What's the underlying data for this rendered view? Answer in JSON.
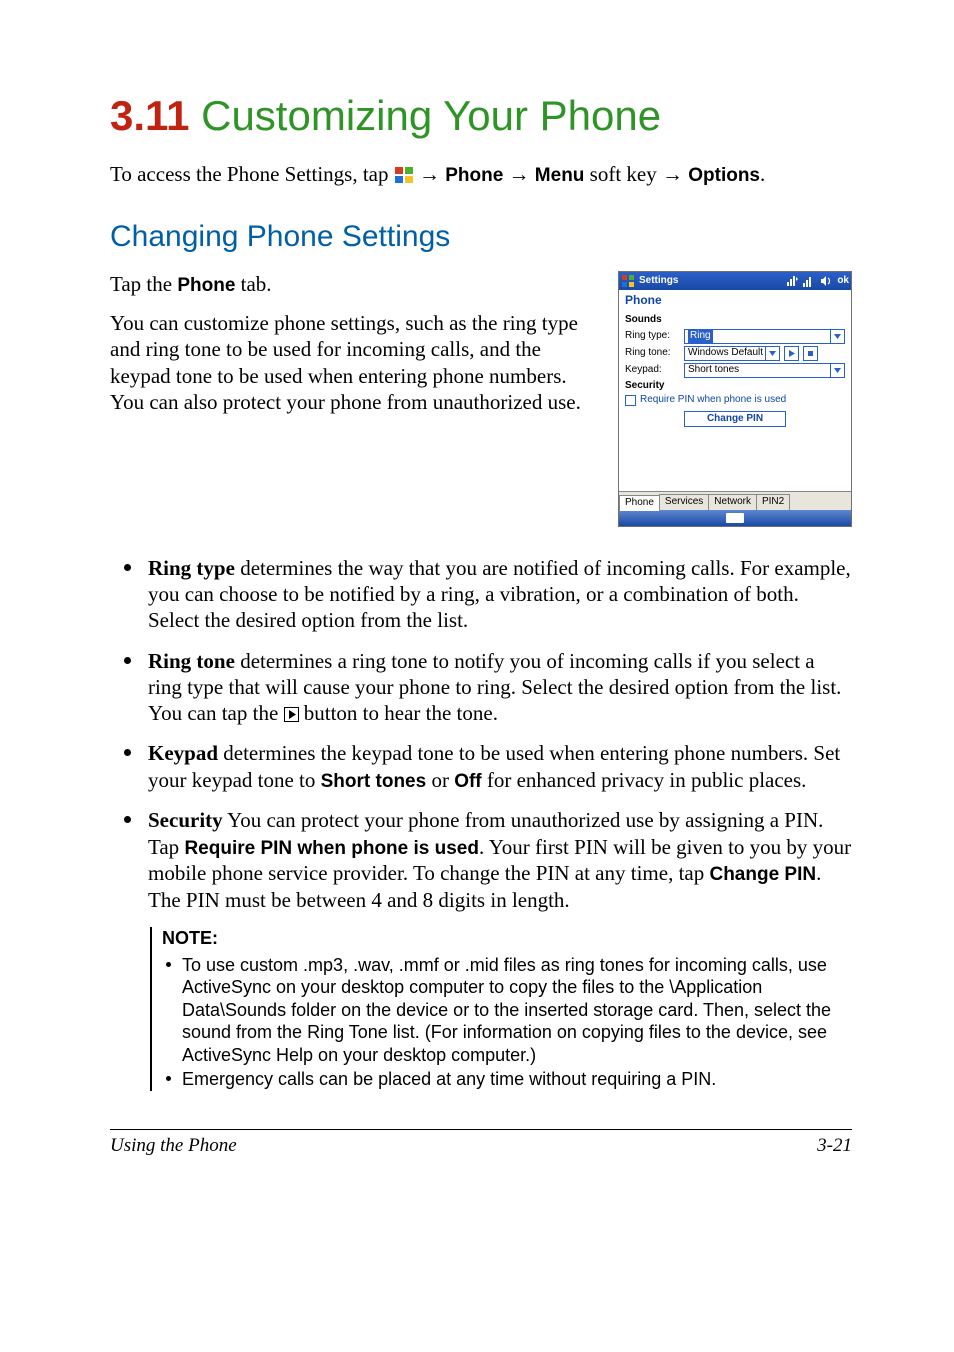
{
  "heading": {
    "number": "3.11",
    "title": "Customizing Your Phone"
  },
  "access_line": {
    "prefix": "To access the Phone Settings, tap ",
    "step1": "Phone",
    "step2": "Menu",
    "mid2": " soft key ",
    "step3": "Options",
    "arrow": "→",
    "period": "."
  },
  "subsection_title": "Changing Phone Settings",
  "intro1_prefix": "Tap the ",
  "intro1_bold": "Phone",
  "intro1_suffix": " tab.",
  "intro2": "You can customize phone settings, such as the ring type and ring tone to be used for incoming calls, and the keypad tone to be used when entering phone numbers. You can also protect your phone from unauthorized use.",
  "screenshot": {
    "title": "Settings",
    "ok": "ok",
    "heading": "Phone",
    "sections": {
      "sounds": "Sounds",
      "ring_type_label": "Ring type:",
      "ring_type_value": "Ring",
      "ring_tone_label": "Ring tone:",
      "ring_tone_value": "Windows Default",
      "keypad_label": "Keypad:",
      "keypad_value": "Short tones",
      "security": "Security",
      "pin_require": "Require PIN when phone is used",
      "change_pin_btn": "Change PIN"
    },
    "tabs": [
      "Phone",
      "Services",
      "Network",
      "PIN2"
    ]
  },
  "bullets": {
    "ring_type": {
      "label": "Ring type",
      "text": "  determines the way that you are notified of incoming calls. For example, you can choose to be notified by a ring, a vibration, or a combination of both. Select the desired option from the list."
    },
    "ring_tone": {
      "label": "Ring tone",
      "pre": "  determines a ring tone to notify you of incoming calls if you select a ring type that will cause your phone to ring. Select the desired option from the list. You can tap the ",
      "post": " button to hear the tone."
    },
    "keypad": {
      "label": "Keypad",
      "pre": "  determines the keypad tone to be used when entering phone numbers. Set your keypad tone to ",
      "opt1": "Short tones",
      "mid": " or ",
      "opt2": "Off",
      "post": " for enhanced privacy in public places."
    },
    "security": {
      "label": "Security",
      "t1": "  You can protect your phone from unauthorized use by assigning a PIN. Tap ",
      "b1": "Require PIN when phone is used",
      "t2": ". Your first PIN will be given to you by your mobile phone service provider. To change the PIN at any time, tap ",
      "b2": "Change PIN",
      "t3": ". The PIN must be between 4 and 8 digits in length."
    }
  },
  "note": {
    "label": "NOTE:",
    "items": [
      "To use custom .mp3, .wav, .mmf or .mid files as ring tones for incoming calls, use ActiveSync on your desktop computer to copy the files to the \\Application Data\\Sounds folder on the device or to the inserted storage card. Then, select the sound from the Ring Tone list. (For information on copying files to the device, see ActiveSync Help on your desktop computer.)",
      "Emergency calls can be placed at any time without requiring a PIN."
    ]
  },
  "footer": {
    "left": "Using the Phone",
    "right": "3-21"
  }
}
